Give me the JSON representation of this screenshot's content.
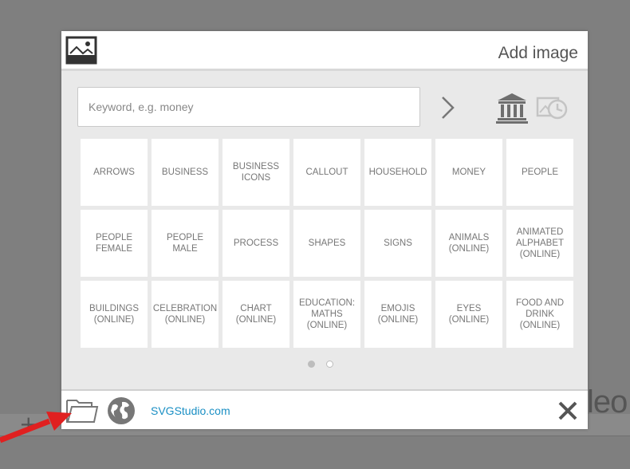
{
  "dialog": {
    "title": "Add image",
    "header_icon": "image-icon",
    "search": {
      "placeholder": "Keyword, e.g. money",
      "value": ""
    },
    "icons": {
      "go": "chevron-right-icon",
      "library": "library-icon",
      "history": "history-icon"
    },
    "categories": [
      "ARROWS",
      "BUSINESS",
      "BUSINESS\nICONS",
      "CALLOUT",
      "HOUSEHOLD",
      "MONEY",
      "PEOPLE",
      "PEOPLE\nFEMALE",
      "PEOPLE MALE",
      "PROCESS",
      "SHAPES",
      "SIGNS",
      "ANIMALS\n(ONLINE)",
      "ANIMATED\nALPHABET\n(ONLINE)",
      "BUILDINGS\n(ONLINE)",
      "CELEBRATION\n(ONLINE)",
      "CHART\n(ONLINE)",
      "EDUCATION:\nMATHS\n(ONLINE)",
      "EMOJIS\n(ONLINE)",
      "EYES (ONLINE)",
      "FOOD AND\nDRINK (ONLINE)"
    ],
    "pagination": {
      "current": 1,
      "total": 2
    },
    "footer": {
      "link_text": "SVGStudio.com",
      "folder_icon": "folder-icon",
      "globe_icon": "globe-icon",
      "close_icon": "close-icon"
    }
  },
  "background": {
    "plus": "+",
    "partial_text": "leo"
  },
  "colors": {
    "overlay": "#7f7f7f",
    "link": "#1a8fc4",
    "arrow": "#e02020"
  }
}
